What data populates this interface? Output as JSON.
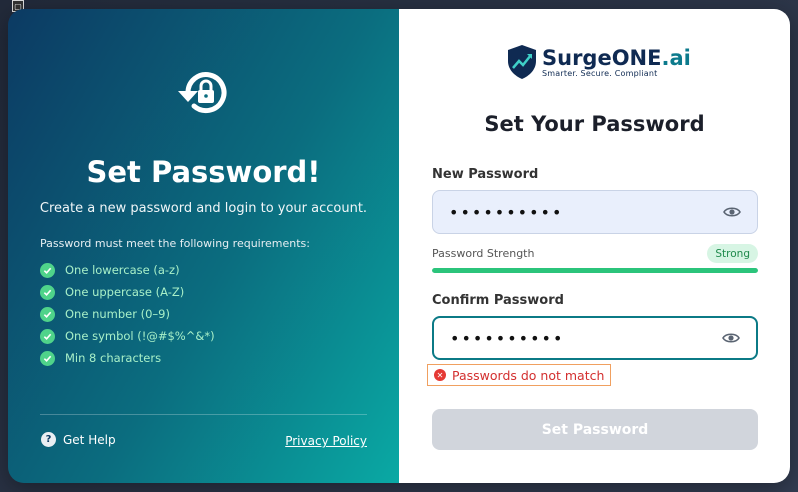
{
  "left": {
    "title": "Set Password!",
    "subtitle": "Create a new password and login to your account.",
    "requirements_title": "Password must meet the following requirements:",
    "requirements": [
      "One lowercase (a-z)",
      "One uppercase (A-Z)",
      "One number (0–9)",
      "One symbol (!@#$%^&*)",
      "Min 8 characters"
    ],
    "help_label": "Get Help",
    "privacy_label": "Privacy Policy"
  },
  "brand": {
    "name_main": "SurgeONE",
    "name_suffix": ".ai",
    "tagline": "Smarter. Secure. Compliant"
  },
  "form": {
    "heading": "Set Your Password",
    "new_password_label": "New Password",
    "new_password_value": "••••••••••",
    "strength_label": "Password Strength",
    "strength_value": "Strong",
    "strength_level": 1.0,
    "confirm_password_label": "Confirm Password",
    "confirm_password_value": "••••••••••",
    "error_message": "Passwords do not match",
    "submit_label": "Set Password"
  },
  "colors": {
    "accent": "#0b7a86",
    "success": "#2bc47b",
    "error": "#d32f2f",
    "disabled": "#d1d5dc"
  },
  "icons": {
    "lock": "lock-reset-icon",
    "check": "check-circle-icon",
    "help": "question-circle-icon",
    "eye": "eye-icon",
    "error": "error-circle-icon"
  }
}
